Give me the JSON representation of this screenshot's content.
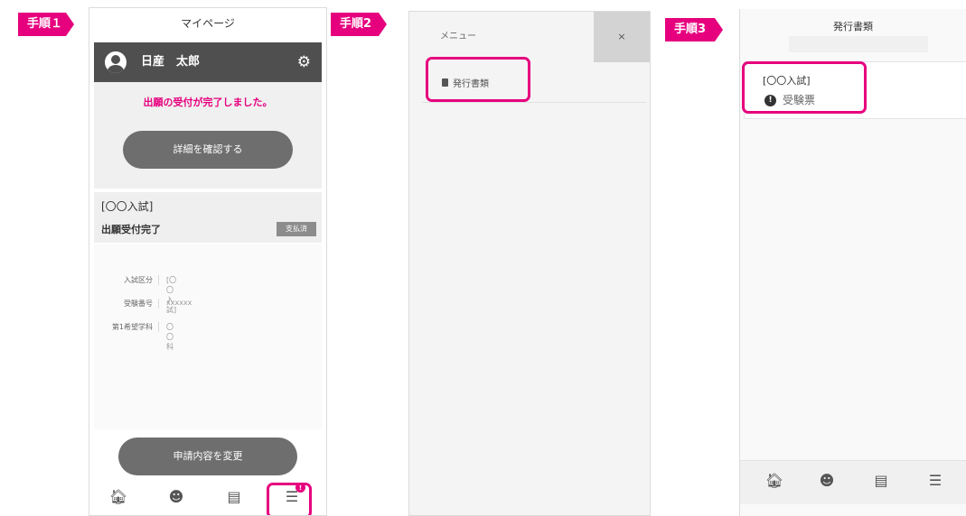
{
  "steps": {
    "step1": "手順１",
    "step2": "手順2",
    "step3": "手順3"
  },
  "phone1": {
    "title": "マイページ",
    "user_name": "日産　太郎",
    "notice": "出願の受付が完了しました。",
    "detail_button": "詳細を確認する",
    "exam_name": "[〇〇入試]",
    "exam_status": "出願受付完了",
    "paid_badge": "支払済",
    "details": [
      {
        "label": "入試区分",
        "value": "[〇〇入試]"
      },
      {
        "label": "受験番号",
        "value": "xxxxxx"
      },
      {
        "label": "第1希望学科",
        "value": "〇〇科"
      }
    ],
    "change_button": "申請内容を変更",
    "menu_badge": "!"
  },
  "phone2": {
    "menu_title": "メニュー",
    "close_label": "×",
    "menu_item": "発行書類"
  },
  "phone3": {
    "title": "発行書類",
    "exam_name": "[〇〇入試]",
    "alert_mark": "!",
    "document": "受験票"
  },
  "nav_icons": [
    "home-icon",
    "face-icon",
    "id-card-icon",
    "menu-icon"
  ],
  "colors": {
    "accent": "#e6007e",
    "header_dark": "#4f4f4f",
    "button_gray": "#6e6e6e"
  }
}
